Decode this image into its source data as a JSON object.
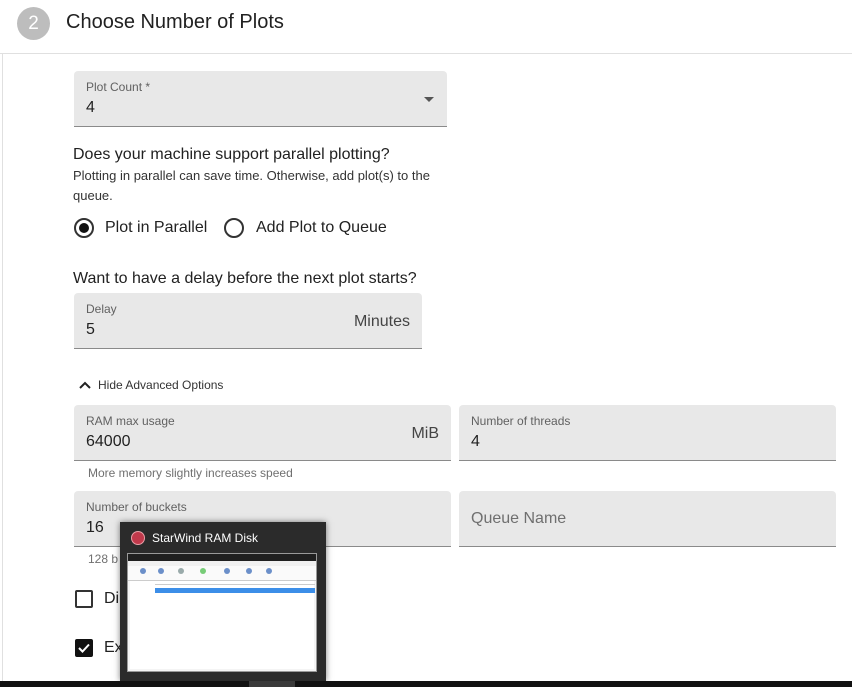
{
  "step": {
    "number": "2",
    "title": "Choose Number of Plots"
  },
  "plot_count": {
    "label": "Plot Count *",
    "value": "4"
  },
  "parallel": {
    "question": "Does your machine support parallel plotting?",
    "description": "Plotting in parallel can save time. Otherwise, add plot(s) to the queue.",
    "options": [
      {
        "label": "Plot in Parallel",
        "checked": true
      },
      {
        "label": "Add Plot to Queue",
        "checked": false
      }
    ]
  },
  "delay": {
    "question": "Want to have a delay before the next plot starts?",
    "label": "Delay",
    "value": "5",
    "suffix": "Minutes"
  },
  "advanced": {
    "toggle_label": "Hide Advanced Options"
  },
  "ram": {
    "label": "RAM max usage",
    "value": "64000",
    "suffix": "MiB",
    "helper": "More memory slightly increases speed"
  },
  "threads": {
    "label": "Number of threads",
    "value": "4"
  },
  "buckets": {
    "label": "Number of buckets",
    "value": "16",
    "helper_partial": "128 b"
  },
  "queue_name": {
    "placeholder": "Queue Name"
  },
  "checkboxes": [
    {
      "label_partial": "Di",
      "checked": false
    },
    {
      "label_partial": "Ex",
      "checked": true
    }
  ],
  "taskbar_thumbnail": {
    "title": "StarWind RAM Disk"
  }
}
